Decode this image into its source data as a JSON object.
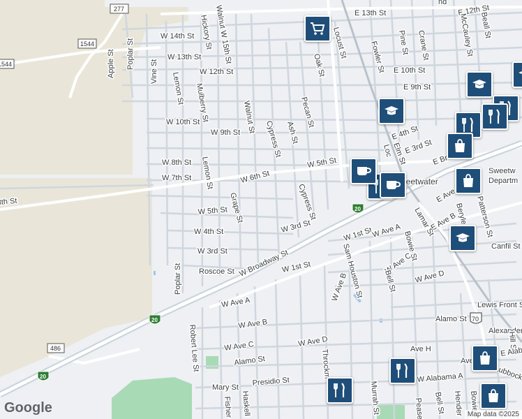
{
  "map": {
    "city_label": "Sweetwater",
    "dept_label": "Sweetw",
    "dept_label2": "Departm",
    "streets": {
      "w15th": "Walnut W 15th St",
      "e13th": "E 13th St",
      "e12th": "E 12th St",
      "w14th": "W 14th St",
      "w13th": "W 13th St",
      "w12th": "W 12th St",
      "e10th": "E 10th St",
      "e9th": "E 9th St",
      "w10th": "W 10th St",
      "w9th": "W 9th St",
      "w8th": "W 8th St",
      "w7th": "W 7th St",
      "w6th": "W 6th St",
      "w5th": "W 5th St",
      "w5th_b": "W 5th St",
      "e4th": "E 4th St",
      "e3rd": "E 3rd St",
      "w4th": "W 4th St",
      "w3rd": "W 3rd St",
      "w3rd_b": "W 3rd St",
      "w1st": "W 1st St",
      "w1st_b": "W 1st St",
      "roscoe": "Roscoe St",
      "broadway": "W Broadway St",
      "w8th_left": "8th St",
      "wavea": "W Ave A",
      "wavea_b": "W Ave A",
      "waveb": "W Ave B",
      "wavec": "W Ave C",
      "wavec_b": "W Ave C",
      "waved": "W Ave D",
      "waved_b": "W Ave D",
      "eavea": "E Ave A",
      "eaveb": "E Ave B",
      "aveh": "Ave H",
      "alamo": "Alamo St",
      "alamo_b": "Alamo St",
      "presidio": "Presidio St",
      "mary": "Mary St",
      "walabama": "W Alabama A",
      "canfil": "Canfil St",
      "lewis": "Lewis Front S",
      "alexander": "Alexander",
      "poplar": "Poplar St",
      "poplar_b": "Poplar St",
      "apple": "Apple St",
      "vine": "Vine St",
      "hickory": "Hickory St",
      "lemon": "Lemon St",
      "lemon_b": "Lemon St",
      "mulberry": "Mulberry St",
      "walnut": "Walnut St",
      "cypress": "Cypress St",
      "cypress_b": "Cypress St",
      "ash": "Ash St",
      "pecan": "Pecan St",
      "grape": "Grape St",
      "oak": "Oak St",
      "locust": "Locust St",
      "fowler": "Fowler St",
      "pine": "Pine St",
      "crane": "Crane St",
      "mccauley": "McCauley St",
      "beall": "Beall St",
      "elm": "Elm St",
      "loc": "Loc",
      "lamar": "Lamar St",
      "bowie": "Bowie St",
      "bell": "Bell St",
      "bell_b": "Bell St",
      "patterson": "Patterson St",
      "beryle": "Beryle St",
      "samhouston": "Sam Houston St",
      "waveb2": "W Ave B",
      "robertlee": "Robert Lee St",
      "fisher": "Fisher",
      "haskell": "Haskell",
      "throckmorton": "Throckm",
      "murrah": "Murrah St",
      "pease": "Pease",
      "hender": "Hender",
      "bowie_b": "Bowie",
      "hill": "Hill St",
      "lubbock": "Lubbock",
      "eabe": "E Alaba",
      "ave": "Ave",
      "e_br": "E Br",
      "st_frag": "St",
      "nd_frag": "nd",
      "e_ave": "E Ave"
    },
    "shields": {
      "fm277": "277",
      "fm1544": "1544",
      "fm1544_left": "1544",
      "fm486": "486",
      "i20_a": "20",
      "i20_b": "20",
      "i20_c": "20",
      "us70": "70"
    },
    "pois": [
      {
        "id": "shopping-cart",
        "icon": "shopping-cart-icon"
      },
      {
        "id": "school-1",
        "icon": "graduation-cap-icon"
      },
      {
        "id": "school-2",
        "icon": "graduation-cap-icon"
      },
      {
        "id": "school-3",
        "icon": "graduation-cap-icon"
      },
      {
        "id": "restaurant-1",
        "icon": "fork-knife-icon"
      },
      {
        "id": "restaurant-2",
        "icon": "fork-knife-icon"
      },
      {
        "id": "restaurant-3",
        "icon": "fork-knife-icon"
      },
      {
        "id": "restaurant-4",
        "icon": "fork-knife-icon"
      },
      {
        "id": "cafe-1",
        "icon": "coffee-cup-icon"
      },
      {
        "id": "cafe-2",
        "icon": "coffee-cup-icon"
      },
      {
        "id": "shopping-bag-1",
        "icon": "shopping-bag-icon"
      },
      {
        "id": "shopping-bag-2",
        "icon": "shopping-bag-icon"
      },
      {
        "id": "shopping-bag-3",
        "icon": "shopping-bag-icon"
      },
      {
        "id": "shopping-bag-4",
        "icon": "shopping-bag-icon"
      }
    ],
    "branding": "Google",
    "attribution": "Map data ©2025"
  }
}
